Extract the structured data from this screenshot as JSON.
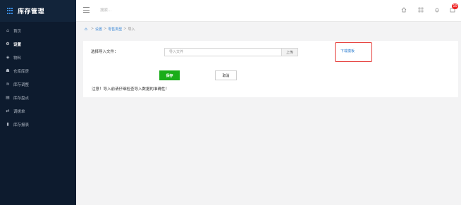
{
  "app": {
    "title": "库存管理"
  },
  "sidebar": {
    "items": [
      {
        "label": "首页",
        "icon": "home-icon",
        "glyph": "⌂"
      },
      {
        "label": "设置",
        "icon": "gear-icon",
        "glyph": "⚙",
        "active": true
      },
      {
        "label": "物料",
        "icon": "cube-icon",
        "glyph": "◈"
      },
      {
        "label": "仓库库房",
        "icon": "warehouse-icon",
        "glyph": "☗"
      },
      {
        "label": "库存调整",
        "icon": "adjust-icon",
        "glyph": "≋"
      },
      {
        "label": "库存盘点",
        "icon": "clipboard-icon",
        "glyph": "▤"
      },
      {
        "label": "调拨单",
        "icon": "transfer-icon",
        "glyph": "⇄"
      },
      {
        "label": "库存报表",
        "icon": "bar-chart-icon",
        "glyph": "▮"
      }
    ]
  },
  "topbar": {
    "search_placeholder": "搜索...",
    "notification_count": "10"
  },
  "breadcrumb": {
    "items": [
      "设置",
      "零售类型",
      "导入"
    ],
    "separator": ">"
  },
  "form": {
    "label": "选择导入文件：",
    "file_placeholder": "导入文件",
    "upload_label": "上传",
    "download_label": "下载模板",
    "save_label": "保存",
    "cancel_label": "取消",
    "note": "注意！导入前请仔细检查导入数据的准确性！"
  },
  "colors": {
    "sidebar_bg": "#0d1b2e",
    "save_button": "#1aad19",
    "link": "#2f7fd0",
    "highlight_border": "#e53935",
    "badge": "#e22222"
  }
}
